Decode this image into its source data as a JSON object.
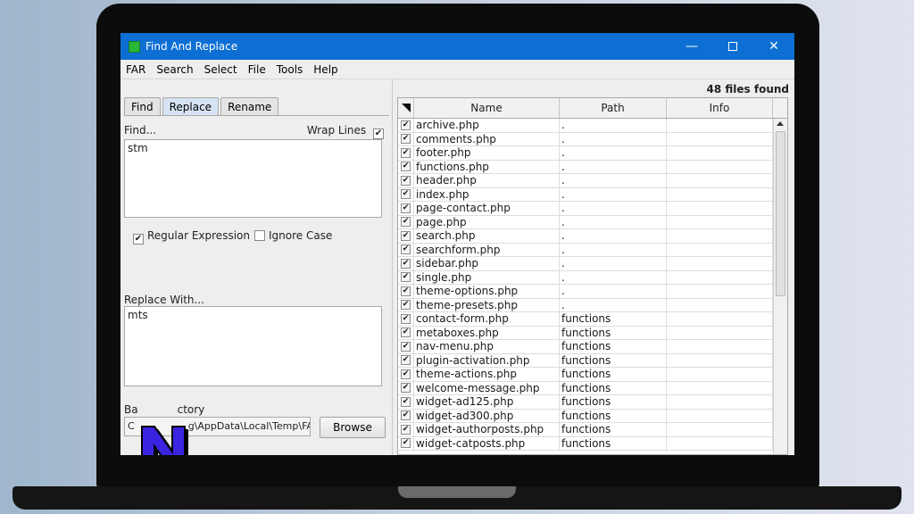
{
  "window": {
    "title": "Find And Replace"
  },
  "menu": [
    "FAR",
    "Search",
    "Select",
    "File",
    "Tools",
    "Help"
  ],
  "tabs": [
    "Find",
    "Replace",
    "Rename"
  ],
  "find": {
    "label": "Find...",
    "value": "stm",
    "wrap_lines_label": "Wrap Lines",
    "wrap_lines_checked": true
  },
  "options": {
    "regex_label": "Regular Expression",
    "regex_checked": true,
    "ignore_case_label": "Ignore Case",
    "ignore_case_checked": false
  },
  "replace": {
    "label": "Replace With...",
    "value": "mts"
  },
  "base_dir": {
    "label_prefix": "Ba",
    "label_suffix": "ctory",
    "value_prefix": "C",
    "value_suffix": "g\\AppData\\Local\\Temp\\FA",
    "browse_label": "Browse"
  },
  "results": {
    "count_label": "48 files found",
    "columns": [
      "Name",
      "Path",
      "Info"
    ],
    "rows": [
      {
        "name": "archive.php",
        "path": "."
      },
      {
        "name": "comments.php",
        "path": "."
      },
      {
        "name": "footer.php",
        "path": "."
      },
      {
        "name": "functions.php",
        "path": "."
      },
      {
        "name": "header.php",
        "path": "."
      },
      {
        "name": "index.php",
        "path": "."
      },
      {
        "name": "page-contact.php",
        "path": "."
      },
      {
        "name": "page.php",
        "path": "."
      },
      {
        "name": "search.php",
        "path": "."
      },
      {
        "name": "searchform.php",
        "path": "."
      },
      {
        "name": "sidebar.php",
        "path": "."
      },
      {
        "name": "single.php",
        "path": "."
      },
      {
        "name": "theme-options.php",
        "path": "."
      },
      {
        "name": "theme-presets.php",
        "path": "."
      },
      {
        "name": "contact-form.php",
        "path": "functions"
      },
      {
        "name": "metaboxes.php",
        "path": "functions"
      },
      {
        "name": "nav-menu.php",
        "path": "functions"
      },
      {
        "name": "plugin-activation.php",
        "path": "functions"
      },
      {
        "name": "theme-actions.php",
        "path": "functions"
      },
      {
        "name": "welcome-message.php",
        "path": "functions"
      },
      {
        "name": "widget-ad125.php",
        "path": "functions"
      },
      {
        "name": "widget-ad300.php",
        "path": "functions"
      },
      {
        "name": "widget-authorposts.php",
        "path": "functions"
      },
      {
        "name": "widget-catposts.php",
        "path": "functions"
      }
    ]
  }
}
